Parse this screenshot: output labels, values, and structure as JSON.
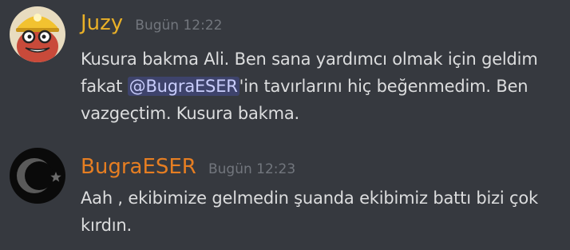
{
  "colors": {
    "background": "#36393f",
    "message_text": "#dcddde",
    "timestamp": "#72767d",
    "mention_text": "#c9cdfb",
    "juzy_name": "#e9b027",
    "bugra_name": "#e67e22"
  },
  "messages": [
    {
      "author": "Juzy",
      "timestamp": "Bugün 12:22",
      "avatar_icon": "miner-character-avatar",
      "content_before": "Kusura bakma Ali. Ben sana yardımcı olmak için geldim fakat ",
      "mention": "@BugraESER",
      "content_after": "'in tavırlarını hiç beğenmedim. Ben vazgeçtim. Kusura bakma."
    },
    {
      "author": "BugraESER",
      "timestamp": "Bugün 12:23",
      "avatar_icon": "crescent-star-flag-avatar",
      "content": "Aah , ekibimize gelmedin şuanda ekibimiz battı bizi çok kırdın."
    }
  ]
}
